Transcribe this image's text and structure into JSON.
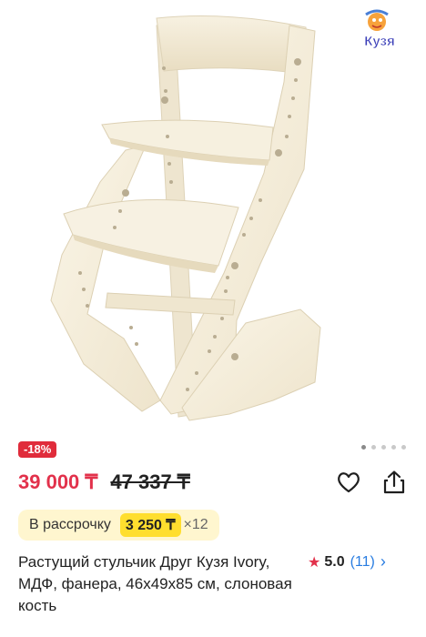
{
  "product": {
    "image_alt": "chair",
    "logo_text": "Кузя",
    "discount_badge": "-18%",
    "price_current": "39 000 ₸",
    "price_old": "47 337 ₸",
    "installment": {
      "label": "В рассрочку",
      "amount": "3 250 ₸",
      "multiplier": "×12"
    },
    "title": "Растущий стульчик Друг Кузя Ivory, МДФ, фанера, 46x49x85 см, слоновая кость",
    "rating": {
      "value": "5.0",
      "count": "(11)"
    }
  },
  "icons": {
    "favorite": "heart-icon",
    "share": "share-icon",
    "rating": "star-icon",
    "more": "chevron-right-icon"
  },
  "colors": {
    "price": "#e2314b",
    "discount_bg": "#e02c3b",
    "installment_bg": "#fff6cf",
    "installment_amount_bg": "#ffde2e",
    "link": "#2a7de1",
    "chair": "#f3ecd9"
  },
  "gallery": {
    "total": 5,
    "active": 1
  }
}
